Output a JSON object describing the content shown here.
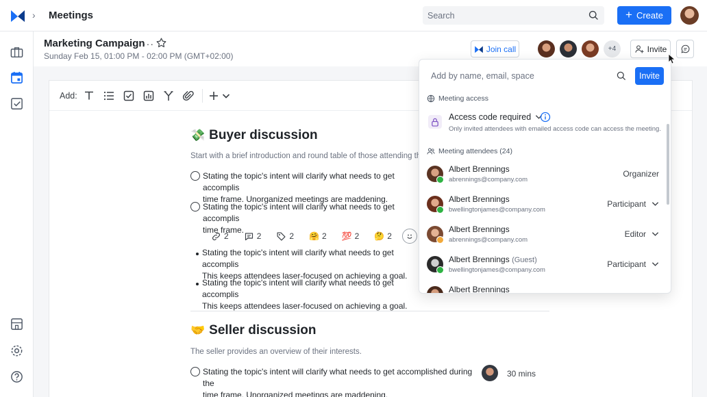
{
  "header": {
    "app_title": "Meetings",
    "search_placeholder": "Search",
    "create_label": "Create"
  },
  "meeting": {
    "title": "Marketing Campaign",
    "more": "···",
    "date": "Sunday Feb 15, 01:00 PM - 02:00 PM (GMT+02:00)",
    "join_label": "Join call",
    "extra_attendees": "+4",
    "invite_label": "Invite"
  },
  "toolbar": {
    "add_label": "Add:",
    "tools": [
      "text-icon",
      "list-icon",
      "checkbox-icon",
      "chart-icon",
      "branch-icon",
      "attachment-icon",
      "plus-icon",
      "chevron-down-icon"
    ]
  },
  "doc": {
    "buyer": {
      "emoji": "💸",
      "heading": "Buyer discussion",
      "intro": "Start with a brief introduction and round table of those attending th",
      "items": [
        {
          "line1": "Stating the topic's intent will clarify what needs to get accomplis",
          "line2": "time frame. Unorganized meetings are maddening."
        },
        {
          "line1": "Stating the topic's intent will clarify what needs to get accomplis",
          "line2": "time frame."
        }
      ],
      "reactions": [
        {
          "icon": "link-icon",
          "glyph": "🔗",
          "count": "2"
        },
        {
          "icon": "comment-icon",
          "glyph": "💬",
          "count": "2"
        },
        {
          "icon": "tag-icon",
          "glyph": "🏷",
          "count": "2"
        },
        {
          "icon": "hug-emoji-icon",
          "glyph": "🤗",
          "count": "2"
        },
        {
          "icon": "hundred-emoji-icon",
          "glyph": "💯",
          "count": "2"
        },
        {
          "icon": "thinking-emoji-icon",
          "glyph": "🤔",
          "count": "2"
        }
      ],
      "bullets": [
        {
          "line1": "Stating the topic's intent will clarify what needs to get accomplis",
          "line2": "This keeps attendees laser-focused on achieving a goal."
        },
        {
          "line1": "Stating the topic's intent will clarify what needs to get accomplis",
          "line2": "This keeps attendees laser-focused on achieving a goal."
        }
      ]
    },
    "seller": {
      "emoji": "🤝",
      "heading": "Seller discussion",
      "intro": "The seller provides an overview of their interests.",
      "item": {
        "line1": "Stating the topic's intent will clarify what needs to get accomplished during the",
        "line2": "time frame. Unorganized meetings are maddening."
      },
      "duration": "30 mins"
    }
  },
  "invite_popover": {
    "input_placeholder": "Add by name, email, space",
    "invite_label": "Invite",
    "access_label": "Meeting access",
    "access_value": "Access code required",
    "access_note": "Only invited attendees with emailed access code can access the meeting.",
    "attendees_label": "Meeting attendees (24)",
    "attendees": [
      {
        "name": "Albert Brennings",
        "guest": "",
        "email": "abrennings@company.com",
        "role": "Organizer",
        "dropdown": false,
        "status": "online"
      },
      {
        "name": "Albert Brennings",
        "guest": "",
        "email": "bwellingtonjames@company.com",
        "role": "Participant",
        "dropdown": true,
        "status": "online"
      },
      {
        "name": "Albert Brennings",
        "guest": "",
        "email": "abrennings@company.com",
        "role": "Editor",
        "dropdown": true,
        "status": "away"
      },
      {
        "name": "Albert Brennings",
        "guest": "(Guest)",
        "email": "bwellingtonjames@company.com",
        "role": "Participant",
        "dropdown": true,
        "status": "online"
      },
      {
        "name": "Albert Brennings",
        "guest": "",
        "email": "",
        "role": "",
        "dropdown": false,
        "status": "online"
      }
    ]
  },
  "colors": {
    "accent": "#1a6ff5",
    "online": "#2fb344",
    "away": "#f2a93b"
  }
}
